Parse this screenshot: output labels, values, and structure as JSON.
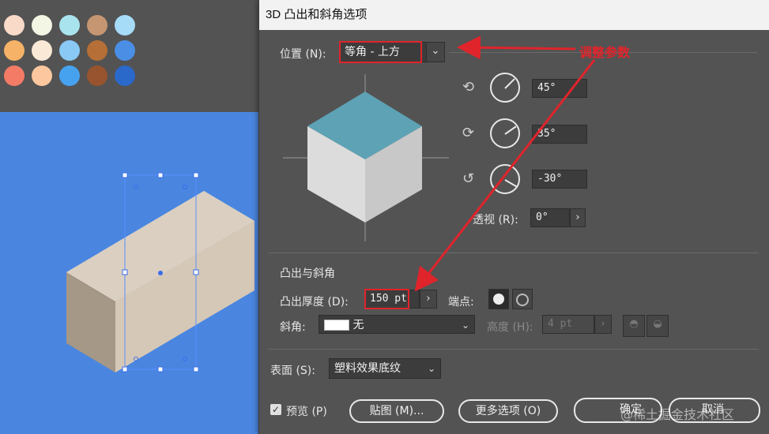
{
  "swatch_colors": [
    [
      "#f9d9c8",
      "#f3f6e4",
      "#a9e3ee",
      "#c69672",
      "#a6dcf8"
    ],
    [
      "#f6b266",
      "#fbe9d7",
      "#89c9f4",
      "#b66f36",
      "#4a8ee5"
    ],
    [
      "#f47b65",
      "#fcc79e",
      "#46a2ee",
      "#98542e",
      "#2a68c9"
    ]
  ],
  "dialog": {
    "title": "3D 凸出和斜角选项",
    "position": {
      "label": "位置 (N):",
      "value": "等角 - 上方"
    },
    "rotation": {
      "x_value": "45°",
      "y_value": "35°",
      "z_value": "-30°"
    },
    "perspective": {
      "label": "透视 (R):",
      "value": "0°"
    },
    "extrude_section": {
      "heading": "凸出与斜角",
      "depth_label": "凸出厚度 (D):",
      "depth_value": "150 pt",
      "cap_label": "端点:",
      "bevel_label": "斜角:",
      "bevel_value": "无",
      "height_label": "高度 (H):",
      "height_value": "4 pt"
    },
    "surface": {
      "label": "表面 (S):",
      "value": "塑料效果底纹"
    },
    "preview": {
      "label": "预览 (P)",
      "checked": true
    },
    "buttons": {
      "map": "贴图 (M)...",
      "more_options": "更多选项 (O)",
      "ok": "确定",
      "cancel": "取消"
    }
  },
  "annotation": {
    "text": "调整参数",
    "color": "#e0242b"
  },
  "watermark": "@稀土掘金技术社区"
}
